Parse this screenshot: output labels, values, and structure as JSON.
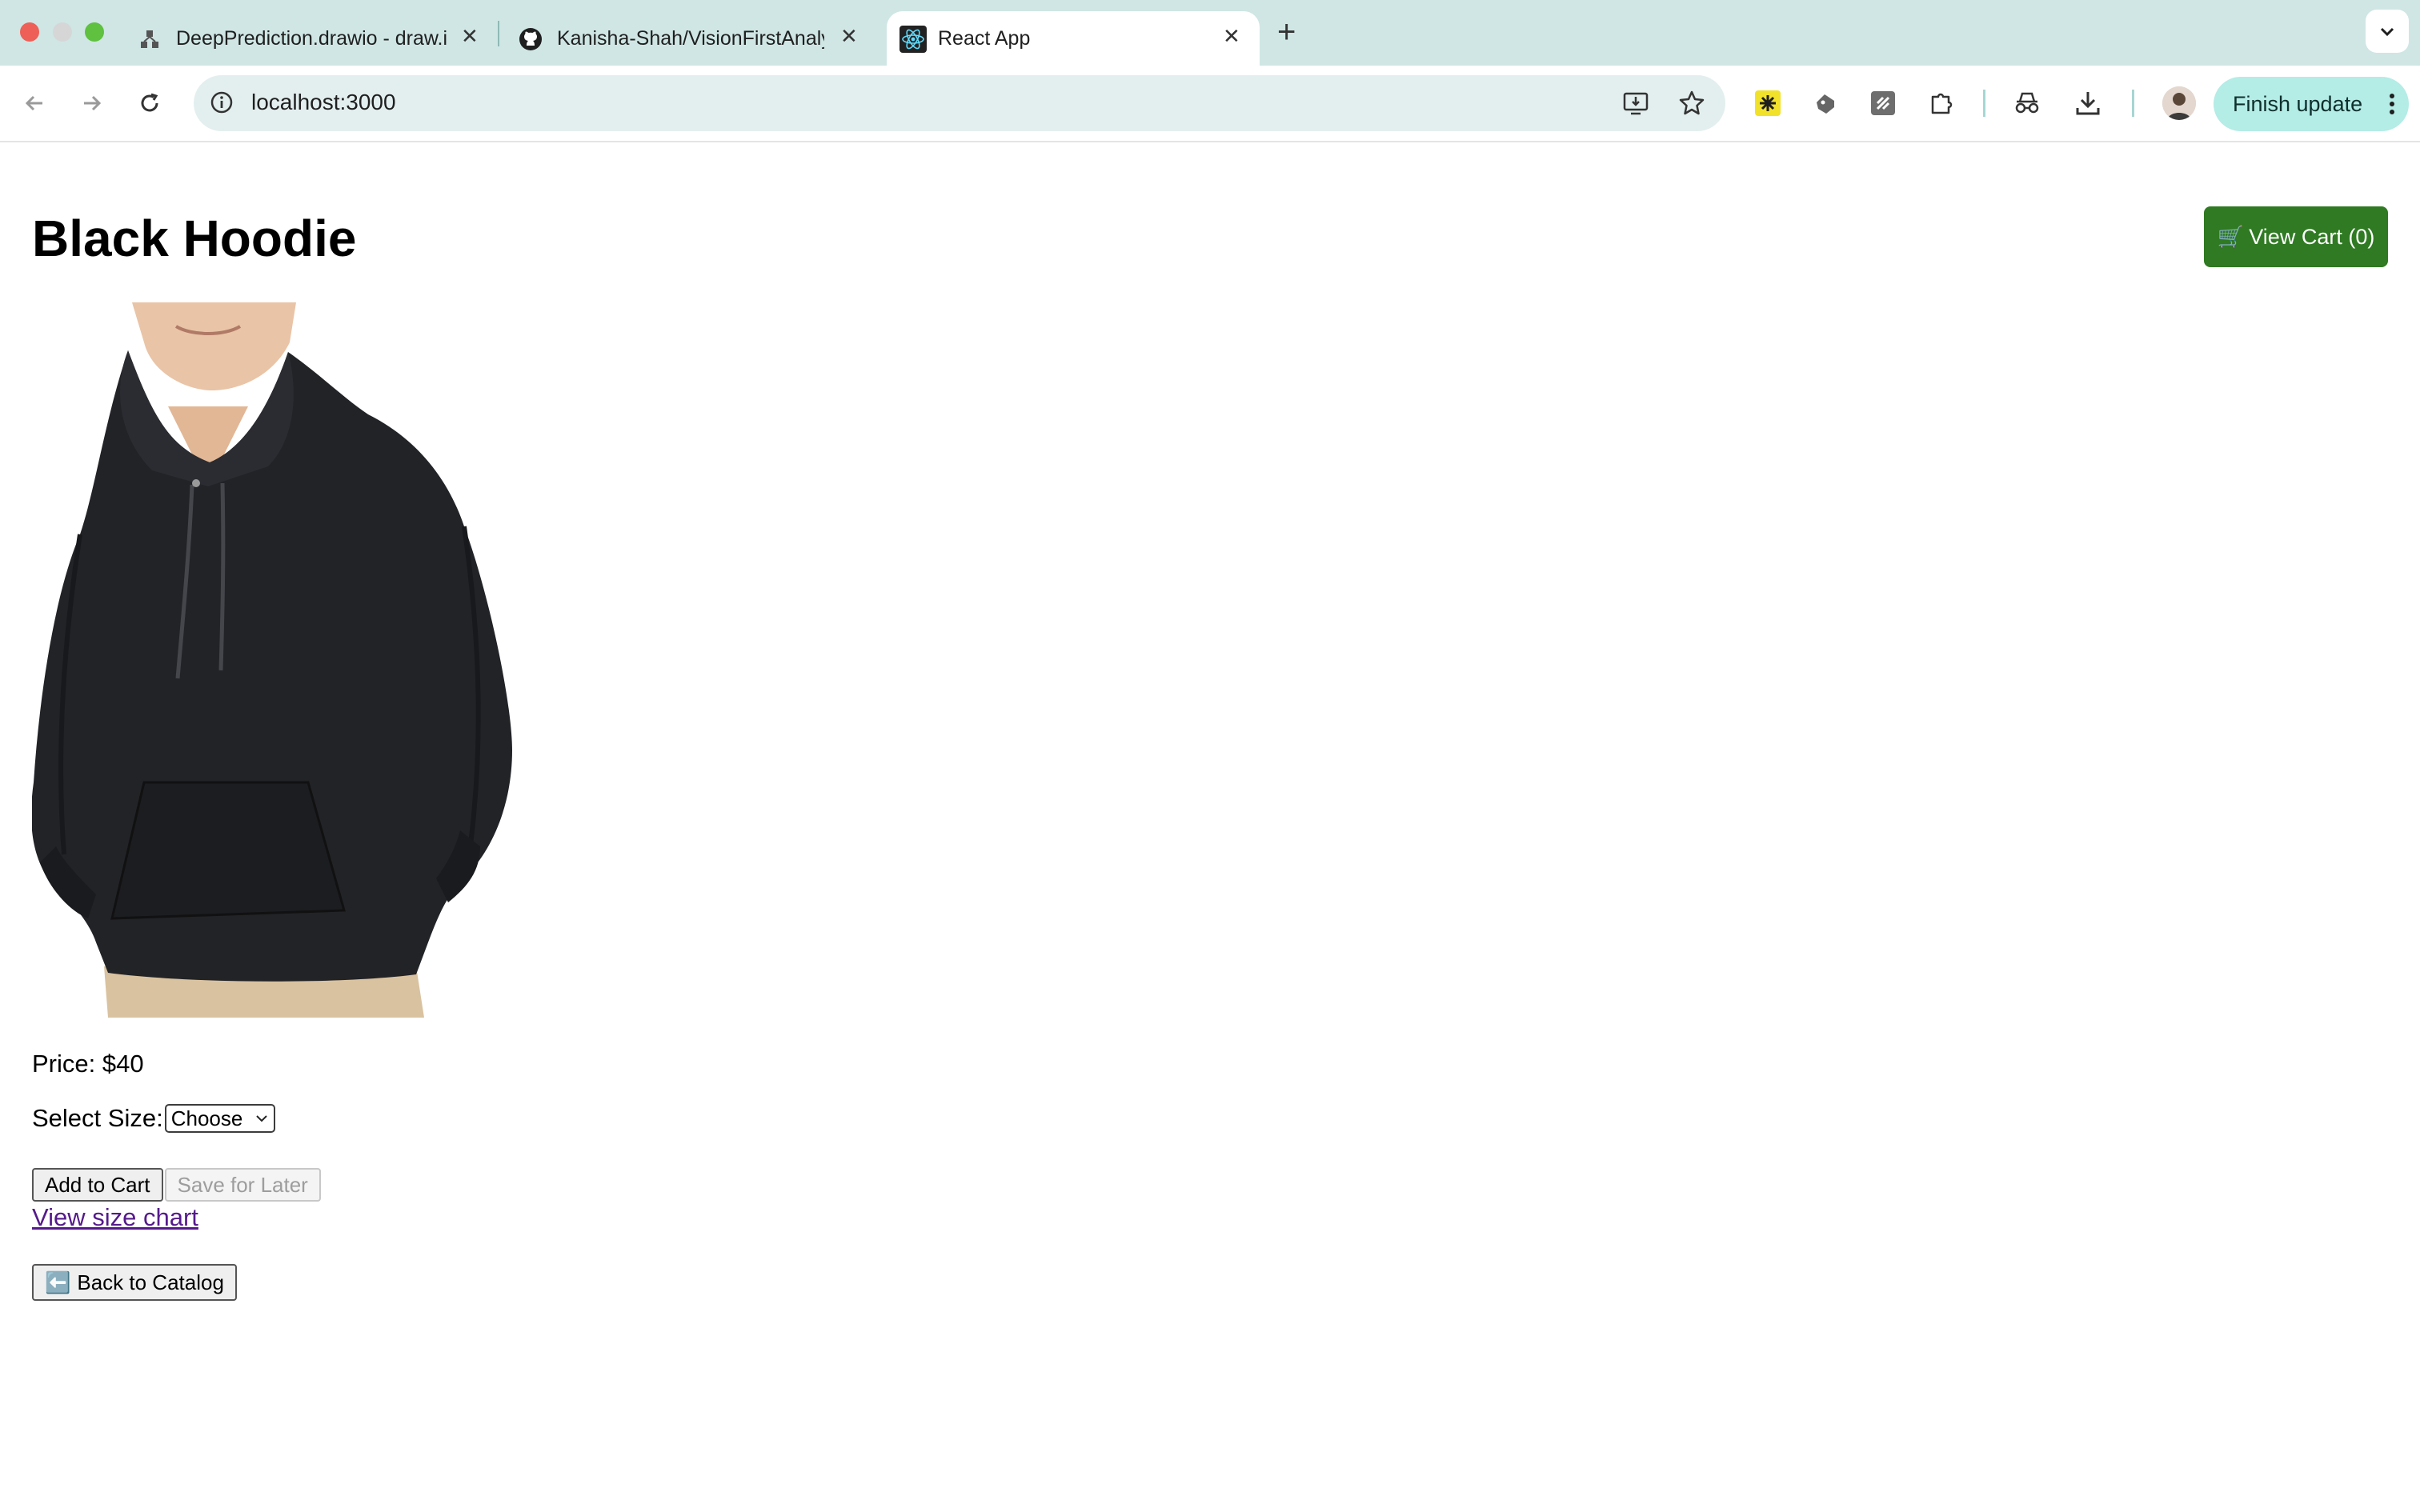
{
  "browser": {
    "tabs": [
      {
        "title": "DeepPrediction.drawio - draw.io",
        "icon": "drawio-icon",
        "active": false
      },
      {
        "title": "Kanisha-Shah/VisionFirstAnalysis",
        "icon": "github-icon",
        "active": false
      },
      {
        "title": "React App",
        "icon": "react-icon",
        "active": true
      }
    ],
    "url": "localhost:3000",
    "finish_update_label": "Finish update"
  },
  "page": {
    "title": "Black Hoodie",
    "cart_icon": "🛒",
    "cart_label": "View Cart (0)",
    "product_image": "black-hoodie-photo",
    "price_label": "Price: $40",
    "size_label": "Select Size:",
    "size_selected": "Choose",
    "add_to_cart_label": "Add to Cart",
    "save_for_later_label": "Save for Later",
    "size_chart_link": "View size chart",
    "back_icon": "⬅️",
    "back_label": "Back to Catalog"
  },
  "colors": {
    "tabstrip": "#cfe6e4",
    "cart_button": "#2f7a22",
    "link_visited": "#551a8b",
    "finish_update": "#b4ece6"
  }
}
